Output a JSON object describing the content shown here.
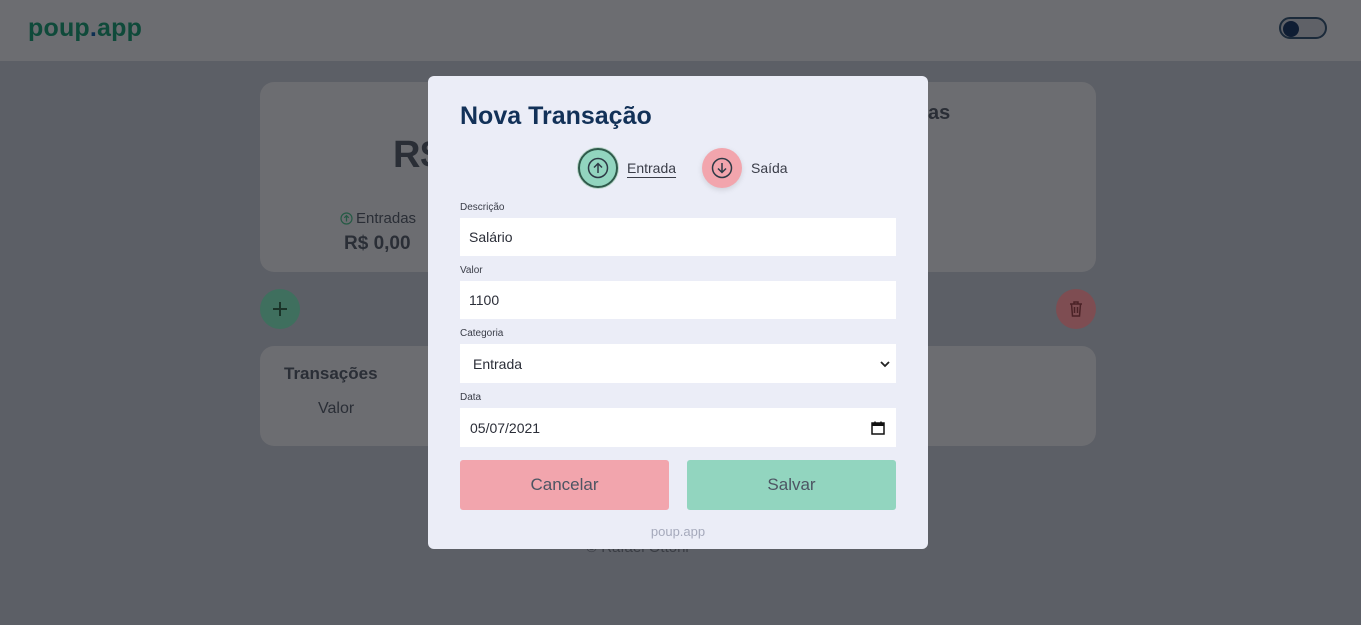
{
  "header": {
    "logo_left": "poup",
    "logo_dot": ".",
    "logo_right": "app"
  },
  "summary": {
    "balance_prefix": "R$",
    "entries_label": "Entradas",
    "entries_value": "R$ 0,00",
    "exits_heading_fragment": "as"
  },
  "transactions": {
    "title": "Transações",
    "col_value": "Valor"
  },
  "footer_credit": "© Rafael Ottoni",
  "modal": {
    "title": "Nova Transação",
    "type_in_label": "Entrada",
    "type_out_label": "Saída",
    "desc_label": "Descrição",
    "desc_value": "Salário",
    "value_label": "Valor",
    "value_value": "1100",
    "category_label": "Categoria",
    "category_selected": "Entrada",
    "date_label": "Data",
    "date_value": "05/07/2021",
    "cancel_label": "Cancelar",
    "save_label": "Salvar",
    "footer": "poup.app"
  },
  "colors": {
    "accent_green": "#92d5bf",
    "accent_red": "#f2a5ad",
    "title_blue": "#123158"
  }
}
